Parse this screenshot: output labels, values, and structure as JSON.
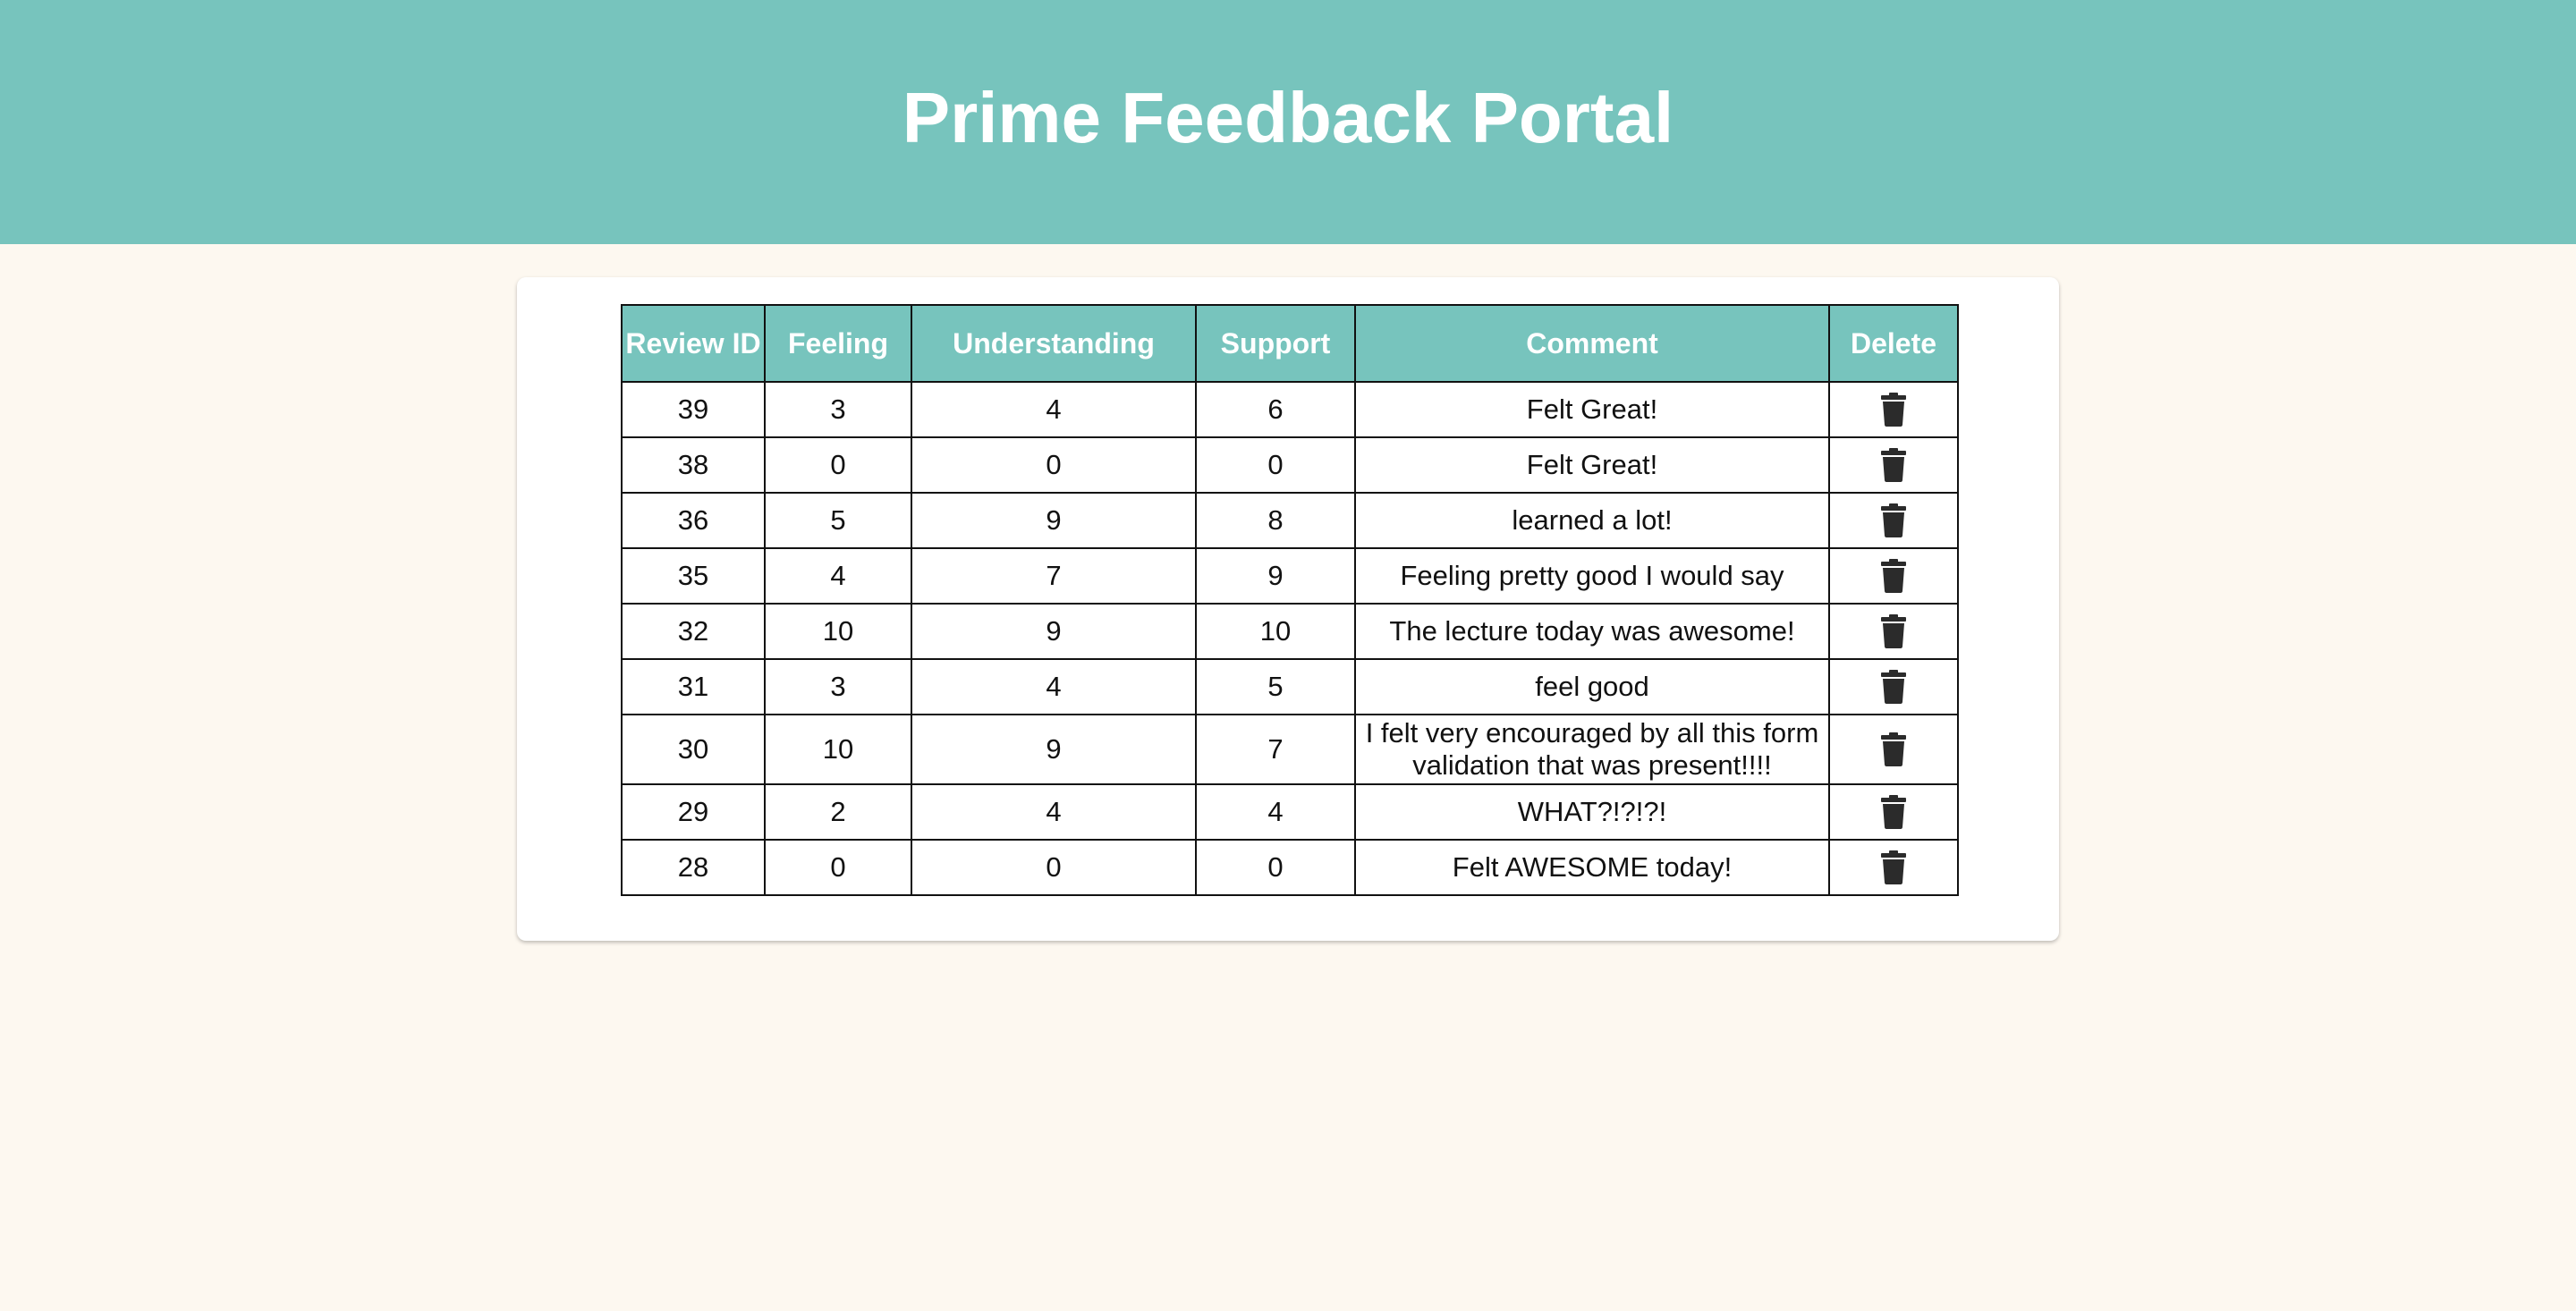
{
  "header": {
    "title": "Prime Feedback Portal"
  },
  "table": {
    "columns": [
      "Review ID",
      "Feeling",
      "Understanding",
      "Support",
      "Comment",
      "Delete"
    ],
    "rows": [
      {
        "id": "39",
        "feeling": "3",
        "understanding": "4",
        "support": "6",
        "comment": "Felt Great!"
      },
      {
        "id": "38",
        "feeling": "0",
        "understanding": "0",
        "support": "0",
        "comment": "Felt Great!"
      },
      {
        "id": "36",
        "feeling": "5",
        "understanding": "9",
        "support": "8",
        "comment": "learned a lot!"
      },
      {
        "id": "35",
        "feeling": "4",
        "understanding": "7",
        "support": "9",
        "comment": "Feeling pretty good I would say"
      },
      {
        "id": "32",
        "feeling": "10",
        "understanding": "9",
        "support": "10",
        "comment": "The lecture today was awesome!"
      },
      {
        "id": "31",
        "feeling": "3",
        "understanding": "4",
        "support": "5",
        "comment": "feel good"
      },
      {
        "id": "30",
        "feeling": "10",
        "understanding": "9",
        "support": "7",
        "comment": "I felt very encouraged by all this form validation that was present!!!!"
      },
      {
        "id": "29",
        "feeling": "2",
        "understanding": "4",
        "support": "4",
        "comment": "WHAT?!?!?!"
      },
      {
        "id": "28",
        "feeling": "0",
        "understanding": "0",
        "support": "0",
        "comment": "Felt AWESOME today!"
      }
    ],
    "delete_icon": "trash-icon"
  },
  "colors": {
    "header_bg": "#77c4bd",
    "page_bg": "#fdf8f0",
    "card_bg": "#ffffff",
    "icon": "#2b2b2b"
  }
}
